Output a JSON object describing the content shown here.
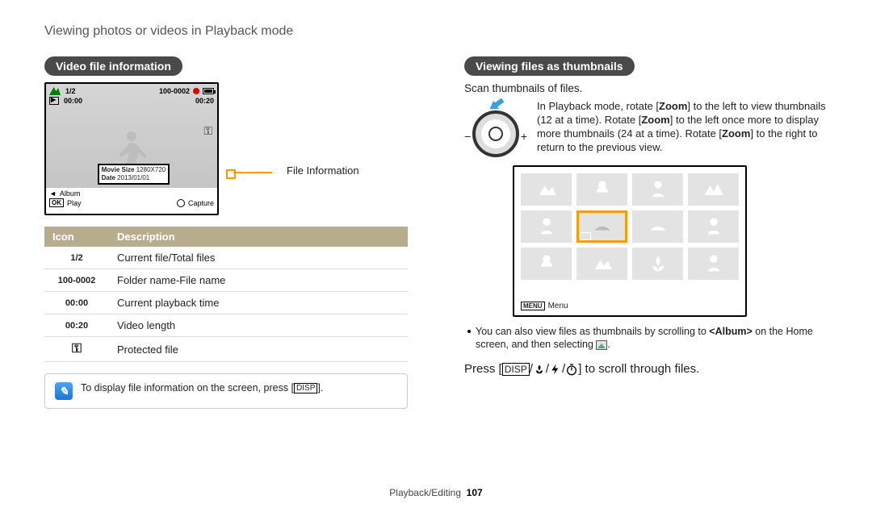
{
  "page_title": "Viewing photos or videos in Playback mode",
  "left": {
    "heading": "Video file information",
    "preview": {
      "count": "1/2",
      "file_id": "100-0002",
      "cur_time": "00:00",
      "length": "00:20",
      "movie_size_label": "Movie Size",
      "movie_size_value": "1280X720",
      "date_label": "Date",
      "date_value": "2013/01/01",
      "album": "Album",
      "play": "Play",
      "capture": "Capture",
      "ok_label": "OK"
    },
    "callout": "File Information",
    "table": {
      "head_icon": "Icon",
      "head_desc": "Description",
      "rows": [
        {
          "icon": "1/2",
          "desc": "Current file/Total files"
        },
        {
          "icon": "100-0002",
          "desc": "Folder name-File name"
        },
        {
          "icon": "00:00",
          "desc": "Current playback time"
        },
        {
          "icon": "00:20",
          "desc": "Video length"
        },
        {
          "icon": "key",
          "desc": "Protected file"
        }
      ]
    },
    "note_pre": "To display file information on the screen, press [",
    "note_disp": "DISP",
    "note_post": "]."
  },
  "right": {
    "heading": "Viewing files as thumbnails",
    "scan": "Scan thumbnails of files.",
    "dial_p1": "In Playback mode, rotate [",
    "dial_bold": "Zoom",
    "dial_p2": "] to the left to view thumbnails (12 at a time). Rotate [",
    "dial_p3": "] to the left once more to display more thumbnails (24 at a time). Rotate [",
    "dial_p4": "] to the right to return to the previous view.",
    "thumb_menu_box": "MENU",
    "thumb_menu": "Menu",
    "bullet_p1": "You can also view files as thumbnails by scrolling to ",
    "bullet_album": "<Album>",
    "bullet_p2": " on the Home screen, and then selecting ",
    "bullet_dot": ".",
    "press_p1": "Press [",
    "press_disp": "DISP",
    "press_p2": "] to scroll through files."
  },
  "footer": {
    "section": "Playback/Editing",
    "page": "107"
  }
}
